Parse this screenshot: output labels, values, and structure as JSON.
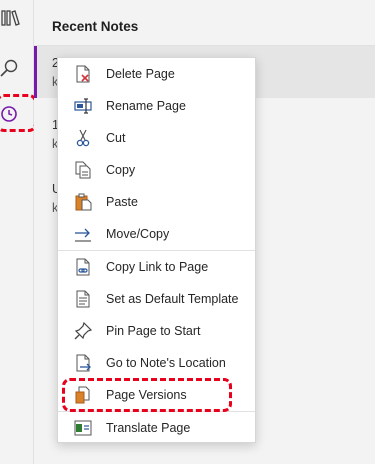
{
  "main": {
    "header": "Recent Notes",
    "notes": [
      {
        "title": "2",
        "sub": "k",
        "selected": true
      },
      {
        "title": "1",
        "sub": "k",
        "selected": false
      },
      {
        "title": "U",
        "sub": "k",
        "selected": false
      }
    ]
  },
  "sidebar": {
    "icons": [
      "notebooks-icon",
      "search-icon",
      "recent-clock-icon"
    ]
  },
  "context_menu": {
    "items": [
      {
        "label": "Delete Page",
        "icon": "delete-page-icon"
      },
      {
        "label": "Rename Page",
        "icon": "rename-page-icon"
      },
      {
        "label": "Cut",
        "icon": "cut-icon"
      },
      {
        "label": "Copy",
        "icon": "copy-icon"
      },
      {
        "label": "Paste",
        "icon": "paste-icon"
      },
      {
        "label": "Move/Copy",
        "icon": "move-copy-icon"
      },
      {
        "label": "Copy Link to Page",
        "icon": "copy-link-icon"
      },
      {
        "label": "Set as Default Template",
        "icon": "template-icon"
      },
      {
        "label": "Pin Page to Start",
        "icon": "pin-icon"
      },
      {
        "label": "Go to Note's Location",
        "icon": "go-to-location-icon"
      },
      {
        "label": "Page Versions",
        "icon": "page-versions-icon"
      },
      {
        "label": "Translate Page",
        "icon": "translate-icon"
      }
    ]
  },
  "colors": {
    "accent": "#7719aa",
    "highlight": "#e8001c",
    "icon_blue": "#2b579a",
    "icon_orange": "#d9822b"
  }
}
